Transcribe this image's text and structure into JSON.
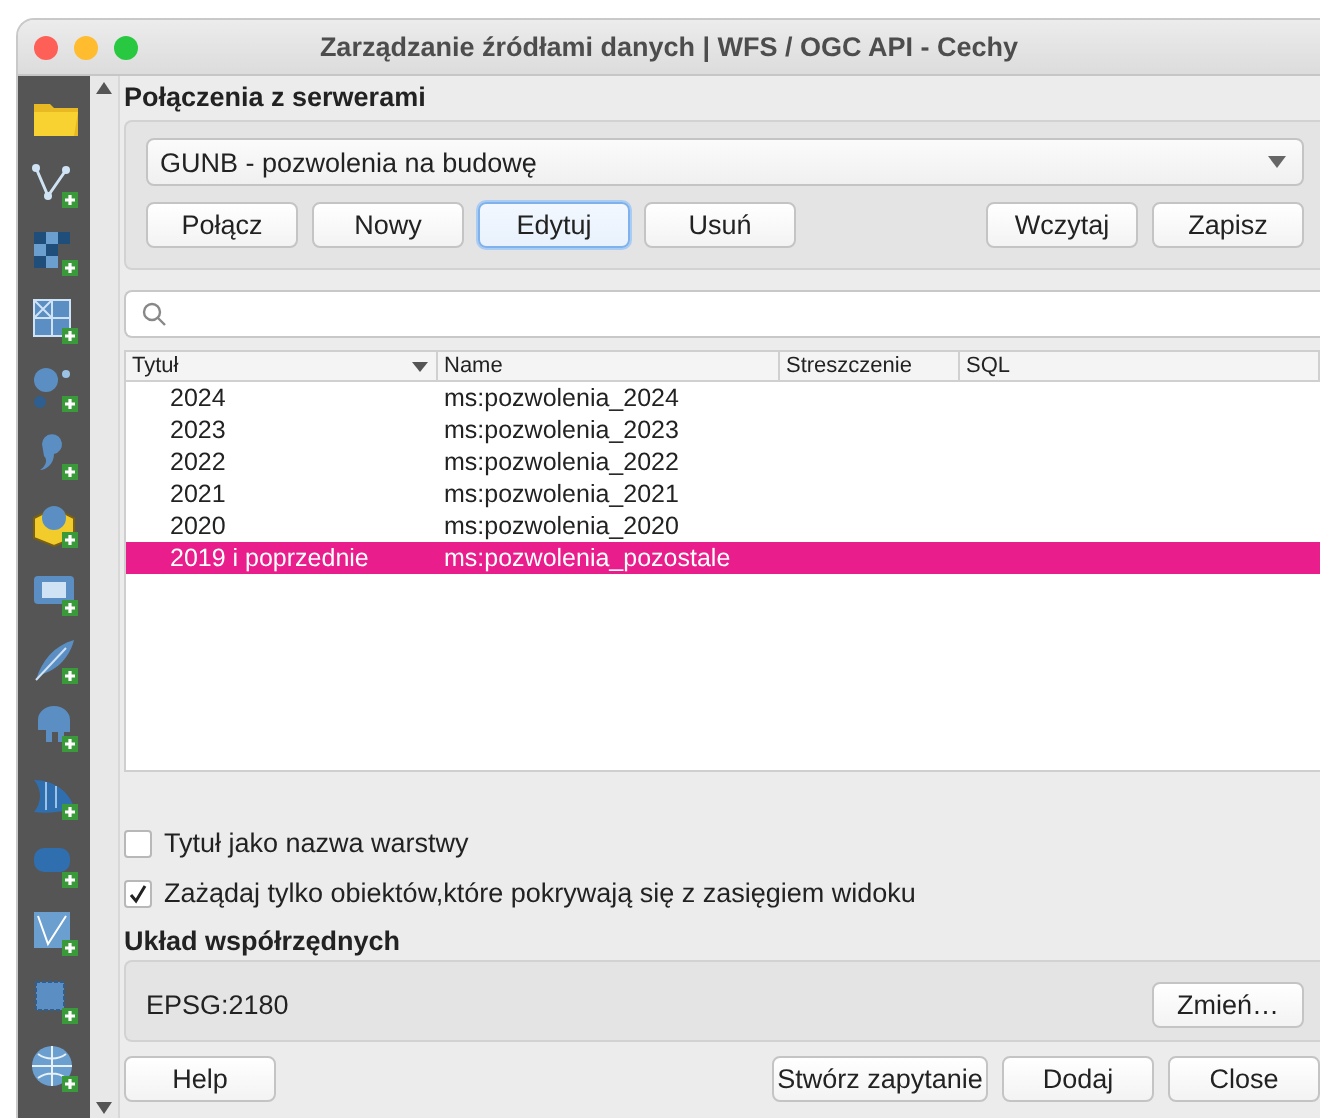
{
  "window": {
    "title": "Zarządzanie źródłami danych | WFS / OGC API - Cechy"
  },
  "connections": {
    "heading": "Połączenia z serwerami",
    "selected_connection": "GUNB - pozwolenia na budowę",
    "left_buttons": [
      {
        "label": "Połącz",
        "focused": false
      },
      {
        "label": "Nowy",
        "focused": false
      },
      {
        "label": "Edytuj",
        "focused": true
      },
      {
        "label": "Usuń",
        "focused": false
      }
    ],
    "right_buttons": [
      {
        "label": "Wczytaj",
        "focused": false
      },
      {
        "label": "Zapisz",
        "focused": false
      }
    ]
  },
  "table": {
    "columns": [
      {
        "label": "Tytuł",
        "sort_indicator": true
      },
      {
        "label": "Name",
        "sort_indicator": false
      },
      {
        "label": "Streszczenie",
        "sort_indicator": false
      },
      {
        "label": "SQL",
        "sort_indicator": false
      }
    ],
    "rows": [
      {
        "title": "2024",
        "name": "ms:pozwolenia_2024",
        "selected": false
      },
      {
        "title": "2023",
        "name": "ms:pozwolenia_2023",
        "selected": false
      },
      {
        "title": "2022",
        "name": "ms:pozwolenia_2022",
        "selected": false
      },
      {
        "title": "2021",
        "name": "ms:pozwolenia_2021",
        "selected": false
      },
      {
        "title": "2020",
        "name": "ms:pozwolenia_2020",
        "selected": false
      },
      {
        "title": "2019 i poprzednie",
        "name": "ms:pozwolenia_pozostale",
        "selected": true
      }
    ]
  },
  "options": [
    {
      "label": "Tytuł jako nazwa warstwy",
      "checked": false
    },
    {
      "label": "Zażądaj tylko obiektów,które pokrywają się z zasięgiem widoku",
      "checked": true
    }
  ],
  "crs": {
    "heading": "Układ współrzędnych",
    "value": "EPSG:2180",
    "change_button": "Zmień…"
  },
  "footer": {
    "help_button": "Help",
    "buttons": [
      "Stwórz zapytanie",
      "Dodaj",
      "Close"
    ]
  }
}
